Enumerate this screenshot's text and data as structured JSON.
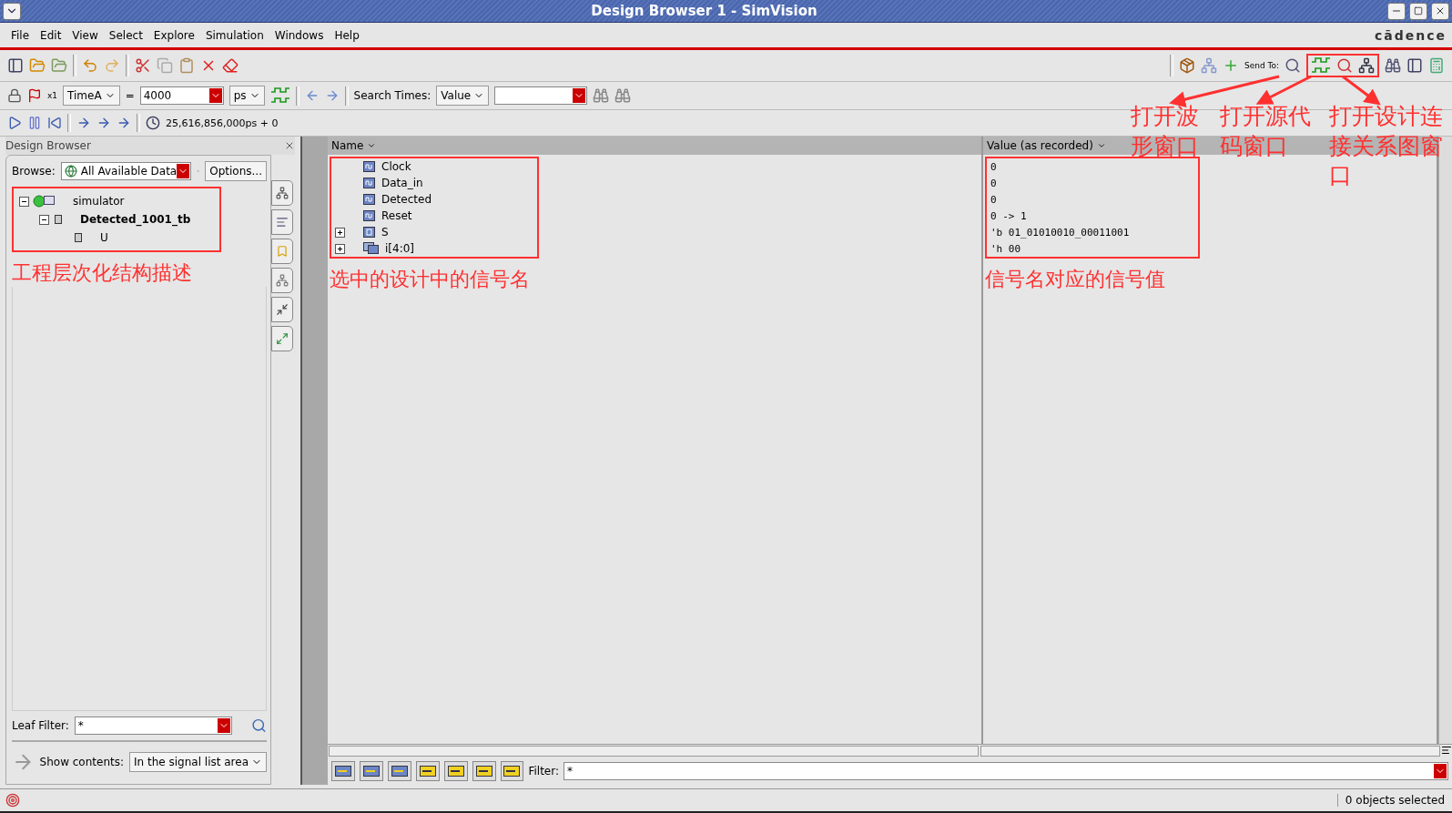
{
  "window": {
    "title": "Design Browser 1 - SimVision"
  },
  "menu": [
    "File",
    "Edit",
    "View",
    "Select",
    "Explore",
    "Simulation",
    "Windows",
    "Help"
  ],
  "brand": "cādence",
  "toolbar": {
    "send_to_label": "Send To:"
  },
  "time_bar": {
    "marker": "TimeA",
    "marker_count": "x1",
    "equals": "=",
    "time": "4000",
    "unit": "ps",
    "search_label": "Search Times:",
    "search_mode": "Value"
  },
  "sim_time": "25,616,856,000ps + 0",
  "design_browser": {
    "title": "Design Browser",
    "browse_label": "Browse:",
    "browse_value": "All Available Data",
    "options_button": "Options...",
    "tree": [
      {
        "label": "simulator",
        "kind": "simulator",
        "current": false,
        "expanded": true,
        "children": [
          {
            "label": "Detected_1001_tb",
            "kind": "module",
            "current": true,
            "expanded": true,
            "children": [
              {
                "label": "U",
                "kind": "module",
                "current": false
              }
            ]
          }
        ]
      }
    ],
    "leaf_filter_label": "Leaf Filter:",
    "leaf_filter_value": "*",
    "show_contents_label": "Show contents:",
    "show_contents_value": "In the signal list area"
  },
  "signals": {
    "columns": [
      "Name",
      "Value (as recorded)"
    ],
    "rows": [
      {
        "name": "Clock",
        "kind": "wire",
        "value": "0"
      },
      {
        "name": "Data_in",
        "kind": "wire",
        "value": "0"
      },
      {
        "name": "Detected",
        "kind": "wire",
        "value": "0"
      },
      {
        "name": "Reset",
        "kind": "wire",
        "value": "0 -> 1"
      },
      {
        "name": "S",
        "kind": "port",
        "expanded": false,
        "value": "'b 01_01010010_00011001"
      },
      {
        "name": "i[4:0]",
        "kind": "bus",
        "expanded": false,
        "value": "'h 00"
      }
    ],
    "filter_label": "Filter:",
    "filter_value": "*"
  },
  "status_bar": {
    "text": "0 objects selected"
  },
  "annotations": {
    "tree_note": "工程层次化结构描述",
    "names_note": "选中的设计中的信号名",
    "values_note": "信号名对应的信号值",
    "send_to_notes": [
      "打开波形窗口",
      "打开源代码窗口",
      "打开设计连接关系图窗口"
    ]
  }
}
